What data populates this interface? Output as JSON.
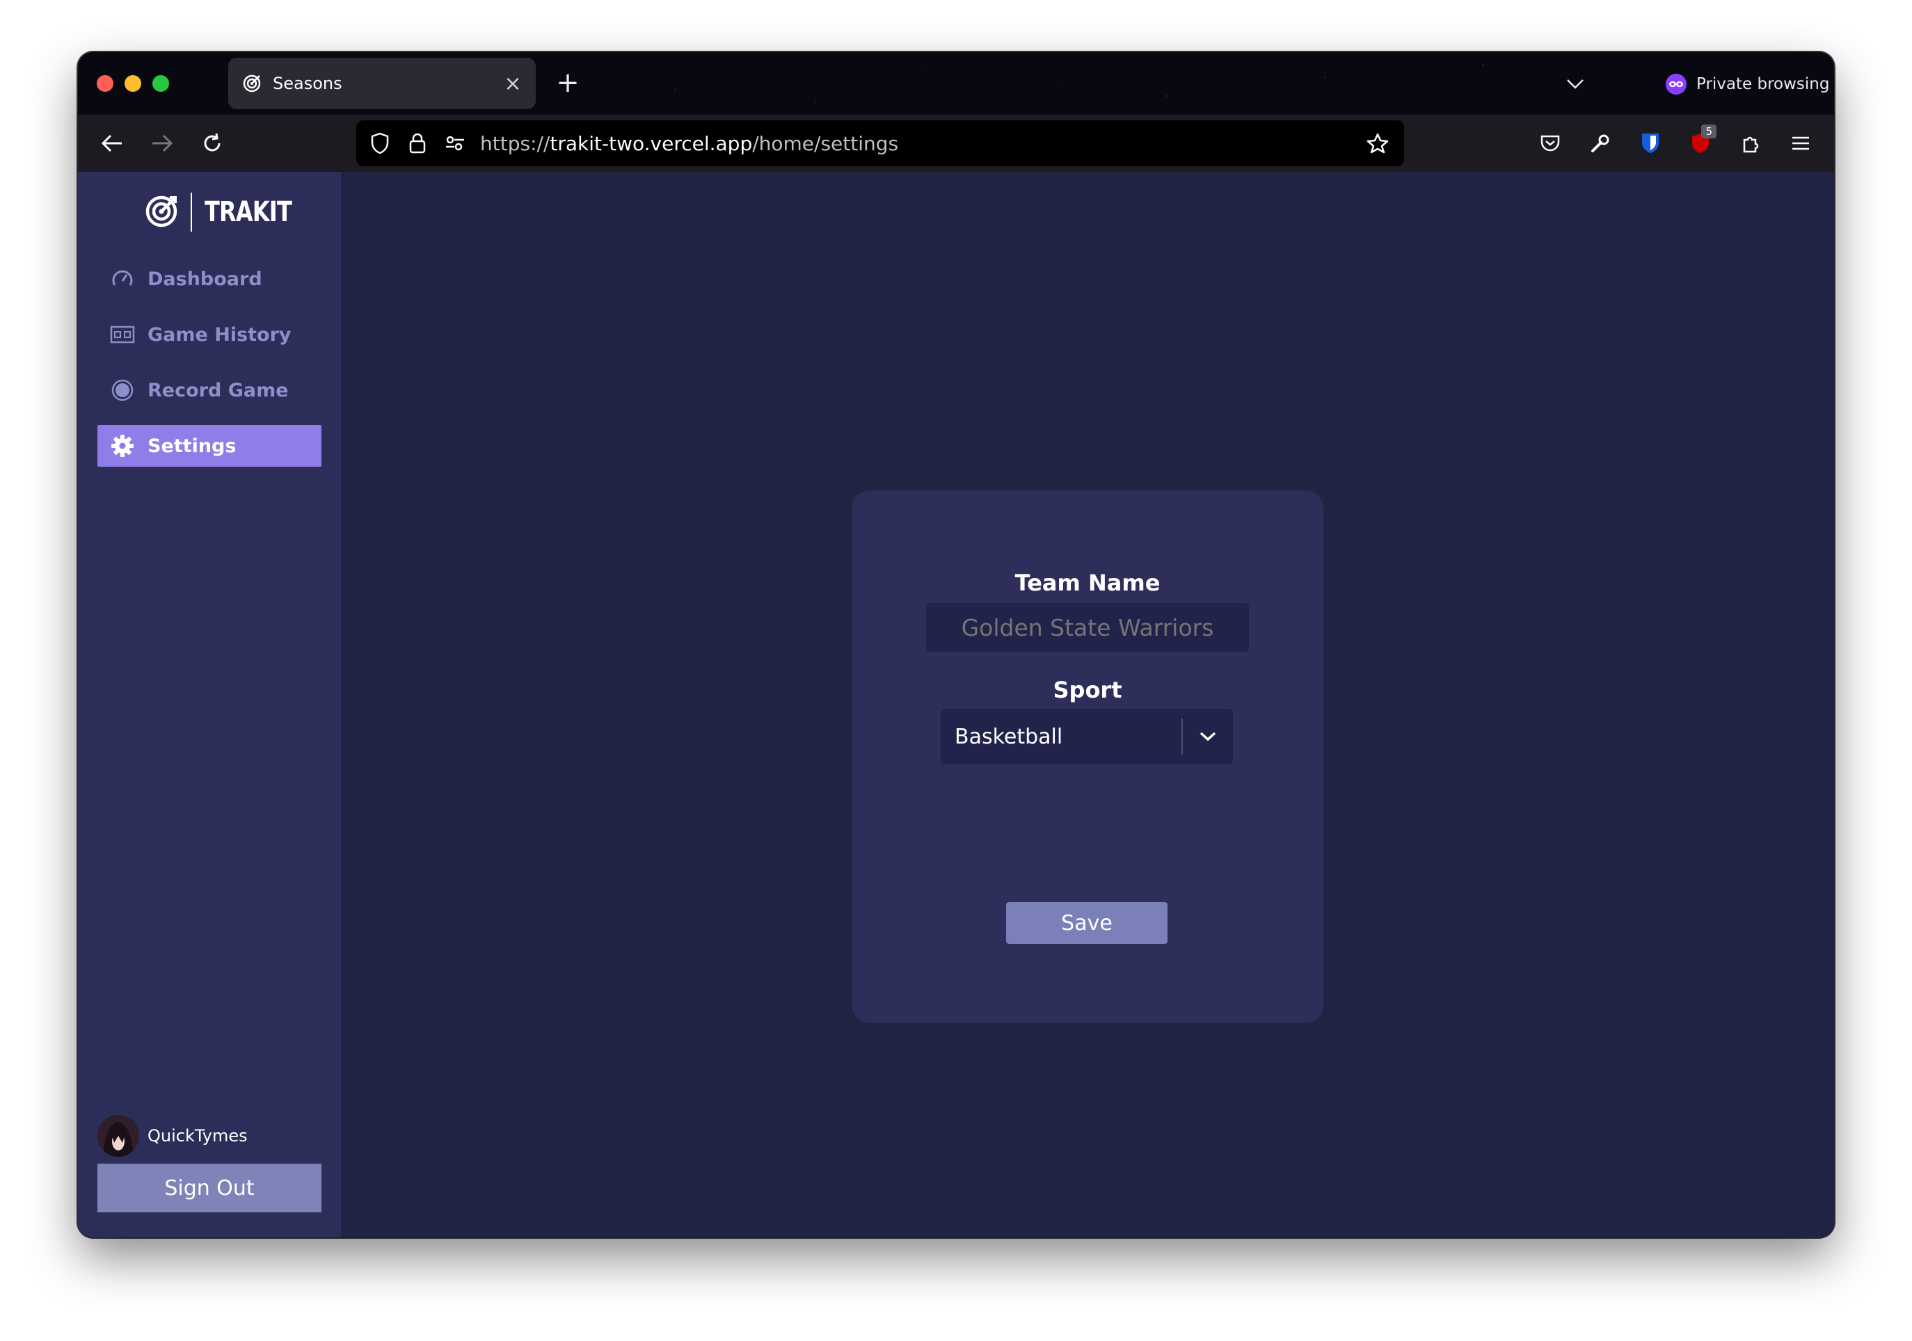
{
  "browser": {
    "tab_title": "Seasons",
    "private_label": "Private browsing",
    "url_scheme": "https://",
    "url_host": "trakit-two.vercel.app",
    "url_path": "/home/settings",
    "extension_badge": "5"
  },
  "app": {
    "brand": "TRAKIT",
    "nav": [
      {
        "label": "Dashboard",
        "icon": "gauge-icon"
      },
      {
        "label": "Game History",
        "icon": "scoreboard-icon"
      },
      {
        "label": "Record Game",
        "icon": "record-icon"
      },
      {
        "label": "Settings",
        "icon": "gear-icon",
        "active": true
      }
    ],
    "user": {
      "name": "QuickTymes"
    },
    "sign_out": "Sign Out"
  },
  "settings": {
    "team_label": "Team Name",
    "team_placeholder": "Golden State Warriors",
    "sport_label": "Sport",
    "sport_value": "Basketball",
    "save_label": "Save"
  },
  "colors": {
    "sidebar": "#2c2d58",
    "main": "#202342",
    "accent": "#8f7de8",
    "button": "#7f83b8"
  }
}
